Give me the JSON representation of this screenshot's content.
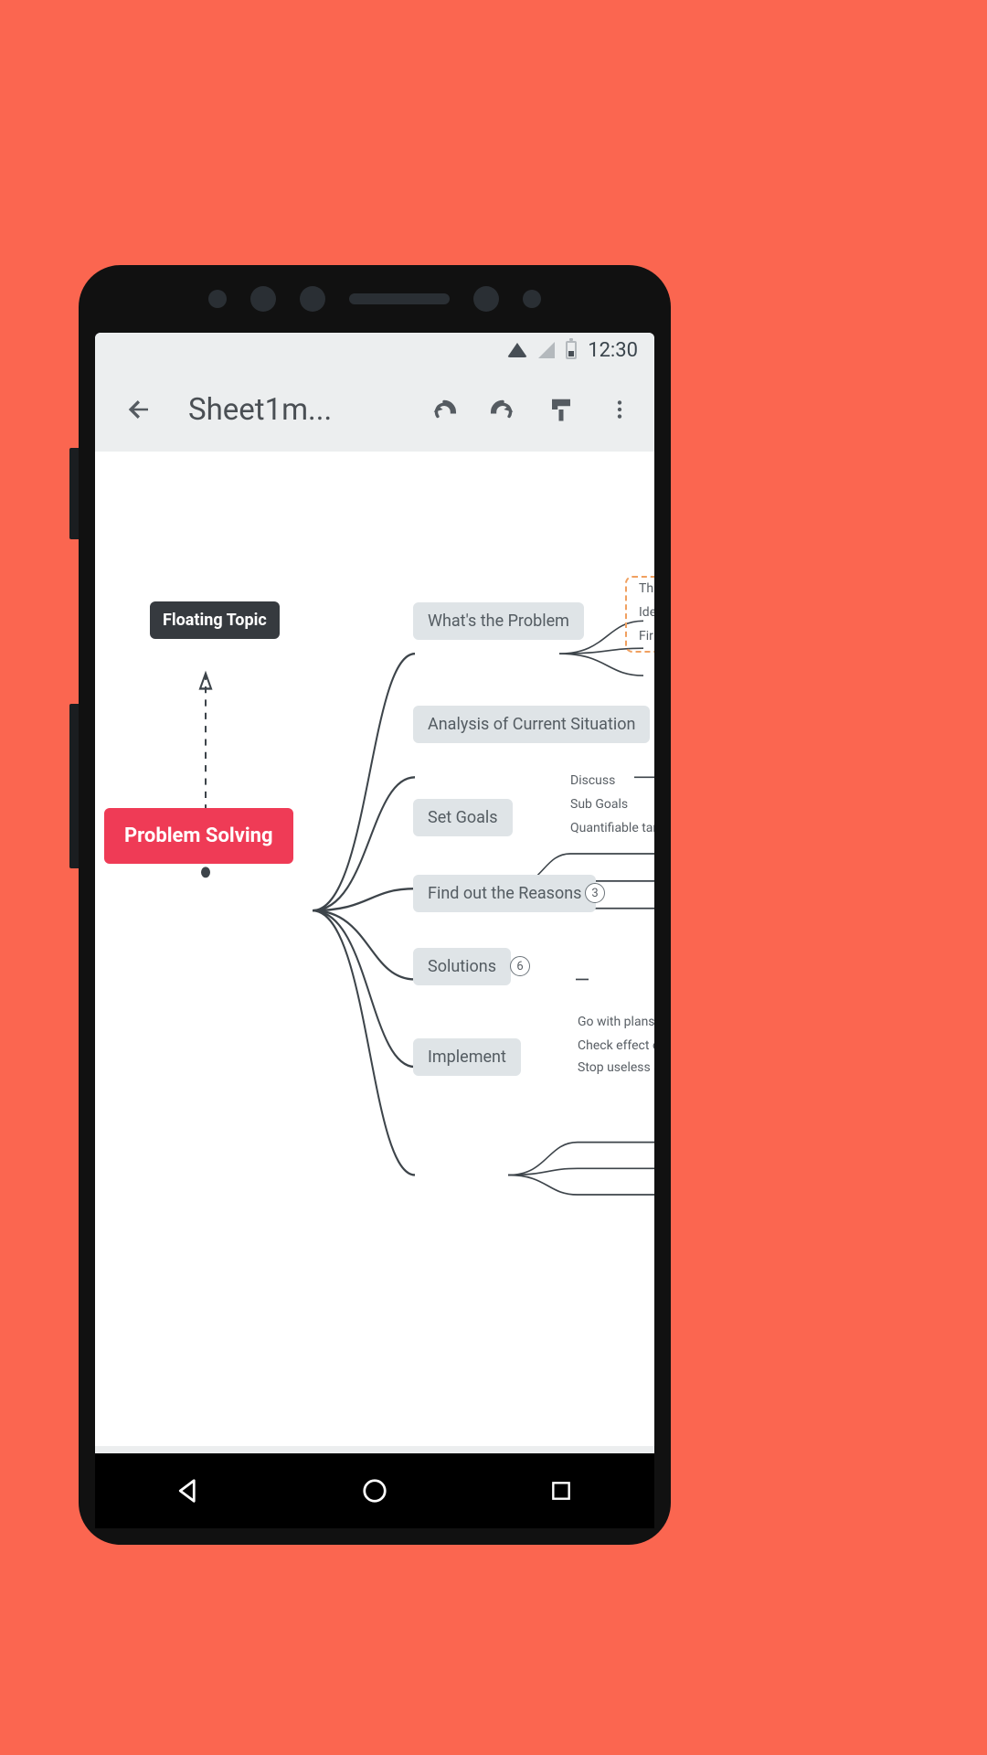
{
  "statusbar": {
    "time": "12:30"
  },
  "appbar": {
    "title": "Sheet1m..."
  },
  "mindmap": {
    "floating": "Floating Topic",
    "root": "Problem Solving",
    "branches": [
      {
        "label": "What's the Problem",
        "children": [
          "Th",
          "Ide",
          "Fir"
        ],
        "highlighted": true
      },
      {
        "label": "Analysis of Current Situation",
        "children": []
      },
      {
        "label": "Set Goals",
        "children": [
          "Discuss",
          "Sub Goals",
          "Quantifiable targe"
        ]
      },
      {
        "label": "Find out the Reasons",
        "count": "3"
      },
      {
        "label": "Solutions",
        "count": "6"
      },
      {
        "label": "Implement",
        "children": [
          "Go with plans",
          "Check effect of",
          "Stop useless so"
        ]
      }
    ]
  }
}
